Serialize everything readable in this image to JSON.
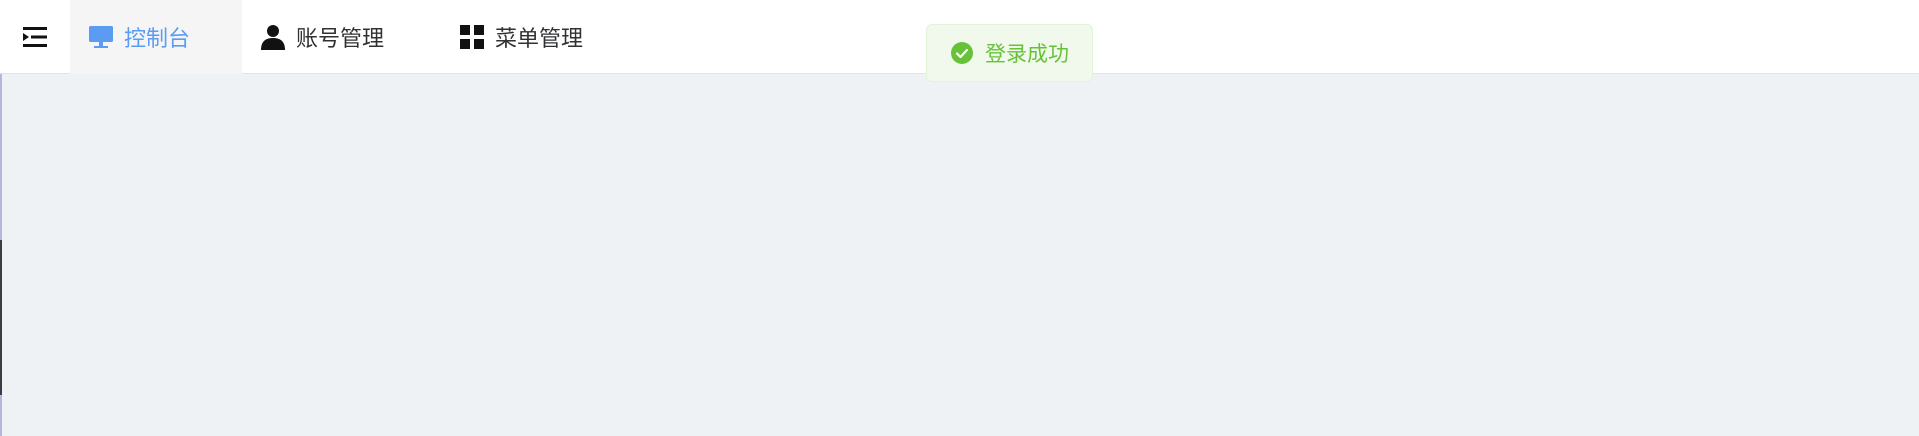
{
  "icons": {
    "collapse": "indent-left-icon",
    "console": "monitor-icon",
    "account": "user-icon",
    "menu": "grid-icon",
    "success": "check-circle-icon"
  },
  "nav": {
    "items": [
      {
        "label": "控制台",
        "active": true
      },
      {
        "label": "账号管理",
        "active": false
      },
      {
        "label": "菜单管理",
        "active": false
      }
    ]
  },
  "toast": {
    "message": "登录成功",
    "type": "success"
  },
  "colors": {
    "accent": "#5b9cf2",
    "success": "#67c23a",
    "toast_bg": "#f0f9eb",
    "page_bg": "#eff2f5"
  }
}
